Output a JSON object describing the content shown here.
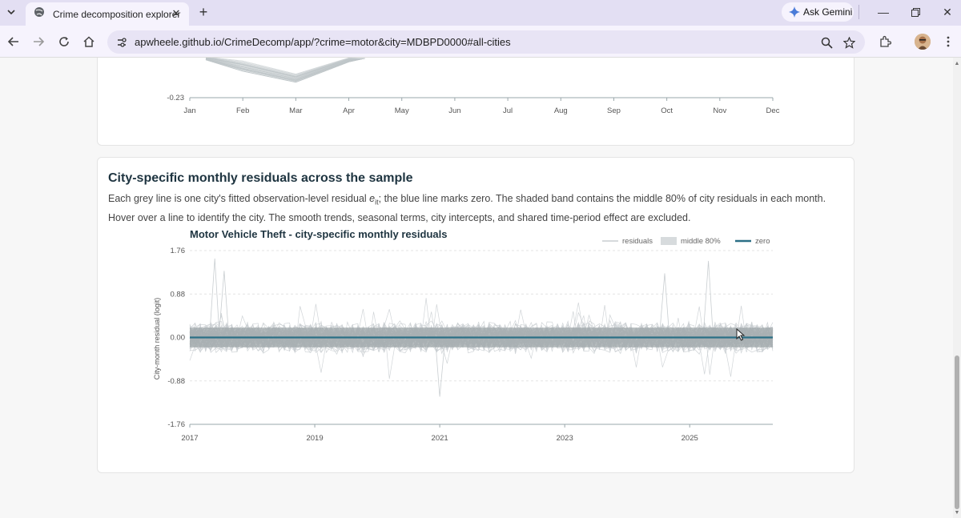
{
  "browser": {
    "tab_title": "Crime decomposition explorer",
    "url": "apwheele.github.io/CrimeDecomp/app/?crime=motor&city=MDBPD0000#all-cities",
    "gemini_label": "Ask Gemini"
  },
  "top_chart": {
    "y_min_label": "-0.23",
    "months": [
      "Jan",
      "Feb",
      "Mar",
      "Apr",
      "May",
      "Jun",
      "Jul",
      "Aug",
      "Sep",
      "Oct",
      "Nov",
      "Dec"
    ]
  },
  "section": {
    "title": "City-specific monthly residuals across the sample",
    "desc_part1": "Each grey line is one city's fitted observation-level residual ",
    "desc_var": "e",
    "desc_sub": "it",
    "desc_part2": "; the blue line marks zero. The shaded band contains the middle 80% of city residuals in each month. Hover over a line to identify the city. The smooth trends, seasonal terms, city intercepts, and shared time-period effect are excluded."
  },
  "chart_data": {
    "type": "line",
    "title": "Motor Vehicle Theft - city-specific monthly residuals",
    "ylabel": "City-month residual (logit)",
    "xlabel": "",
    "y_ticks": [
      "1.76",
      "0.88",
      "0.00",
      "-0.88",
      "-1.76"
    ],
    "y_tick_values": [
      1.76,
      0.88,
      0.0,
      -0.88,
      -1.76
    ],
    "ylim": [
      -1.76,
      1.76
    ],
    "x_ticks": [
      "2017",
      "2019",
      "2021",
      "2023",
      "2025"
    ],
    "x_tick_values": [
      2017,
      2019,
      2021,
      2023,
      2025
    ],
    "xlim": [
      2017,
      2026.33
    ],
    "legend": [
      "residuals",
      "middle 80%",
      "zero"
    ],
    "legend_position": "top-right",
    "band_low": -0.2,
    "band_high": 0.2,
    "zero_line": 0.0,
    "highlighted_spikes": [
      {
        "x": 2017.4,
        "y": 1.6
      },
      {
        "x": 2017.55,
        "y": 1.35
      },
      {
        "x": 2021.0,
        "y": -1.2
      },
      {
        "x": 2024.6,
        "y": 1.3
      },
      {
        "x": 2025.3,
        "y": 1.55
      }
    ],
    "colors": {
      "residual": "#c9ced1",
      "band": "#9ea5a8",
      "zero": "#2b6f86"
    }
  }
}
